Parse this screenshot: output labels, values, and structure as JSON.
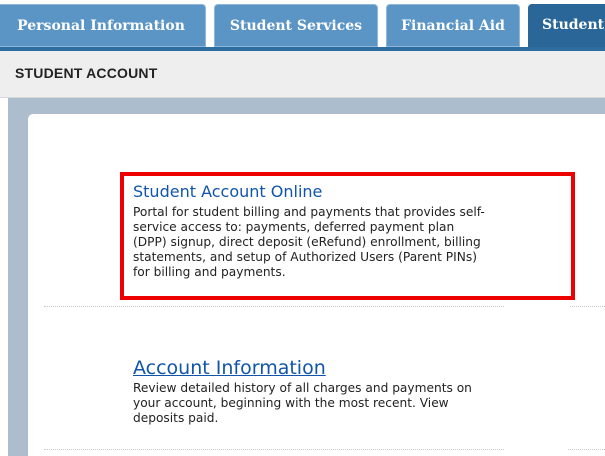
{
  "tabs": [
    {
      "label": "Personal Information",
      "active": false
    },
    {
      "label": "Student Services",
      "active": false
    },
    {
      "label": "Financial Aid",
      "active": false
    },
    {
      "label": "Student",
      "active": true
    }
  ],
  "section": {
    "title": "STUDENT ACCOUNT"
  },
  "entries": [
    {
      "title": "Student Account Online",
      "description_lines": [
        "Portal for student billing and payments that provides self-",
        "service access to: payments, deferred payment plan",
        "(DPP) signup, direct deposit (eRefund) enrollment, billing",
        "statements, and setup of Authorized Users (Parent PINs)",
        "for billing and payments."
      ],
      "highlighted": true
    },
    {
      "title": "Account Information",
      "description_lines": [
        "Review detailed history of all charges and payments on",
        "your account, beginning with the most recent. View",
        "deposits paid."
      ],
      "highlighted": false
    }
  ],
  "colors": {
    "tab_inactive": "#5a95c6",
    "tab_active": "#2a6698",
    "link": "#1155aa",
    "highlight_border": "#ee0000",
    "frame": "#acbdcd"
  }
}
